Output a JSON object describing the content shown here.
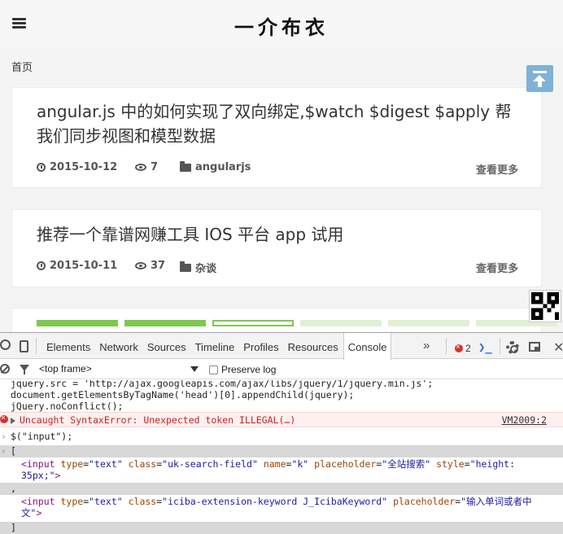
{
  "site": {
    "title": "一介布衣",
    "breadcrumb": "首页",
    "posts": [
      {
        "title": "angular.js 中的如何实现了双向绑定,$watch $digest $apply 帮我们同步视图和模型数据",
        "date": "2015-10-12",
        "views": "7",
        "category": "angularjs",
        "more": "查看更多"
      },
      {
        "title": "推荐一个靠谱网赚工具 IOS 平台 app 试用",
        "date": "2015-10-11",
        "views": "37",
        "category": "杂谈",
        "more": "查看更多"
      }
    ],
    "icons": {
      "menu": "hamburger-icon",
      "date": "clock-icon",
      "views": "eye-icon",
      "category": "folder-icon",
      "backtop": "back-to-top-icon",
      "qr": "qr-code"
    },
    "colors": {
      "accent_green": "#7ec84f",
      "backtop_blue": "#7fb2d6"
    }
  },
  "devtools": {
    "tabs": [
      "Elements",
      "Network",
      "Sources",
      "Timeline",
      "Profiles",
      "Resources",
      "Console"
    ],
    "active_tab": "Console",
    "more": "»",
    "error_count": "2",
    "drawer_icon": "❯_",
    "frame_select": "<top frame>",
    "preserve_log": "Preserve log",
    "console": {
      "code_lines": [
        "jquery.src = 'http://ajax.googleapis.com/ajax/libs/jquery/1/jquery.min.js';",
        "document.getElementsByTagName('head')[0].appendChild(jquery);",
        "jQuery.noConflict();"
      ],
      "error": "Uncaught SyntaxError: Unexpected token ILLEGAL(…)",
      "error_source": "VM2009:2",
      "input": "$(\"input\");",
      "open_bracket": "[",
      "comma": ",",
      "close_bracket": "]",
      "node1": {
        "tag_open": "<input",
        "a1": "type",
        "v1": "\"text\"",
        "a2": "class",
        "v2": "\"uk-search-field\"",
        "a3": "name",
        "v3": "\"k\"",
        "a4": "placeholder",
        "v4": "\"全站搜索\"",
        "a5": "style",
        "v5": "\"height: 35px;\"",
        "tag_close": ">"
      },
      "node2": {
        "tag_open": "<input",
        "a1": "type",
        "v1": "\"text\"",
        "a2": "class",
        "v2": "\"iciba-extension-keyword J_IcibaKeyword\"",
        "a3": "placeholder",
        "v3": "\"输入单词或者中文\"",
        "tag_close": ">"
      }
    }
  }
}
